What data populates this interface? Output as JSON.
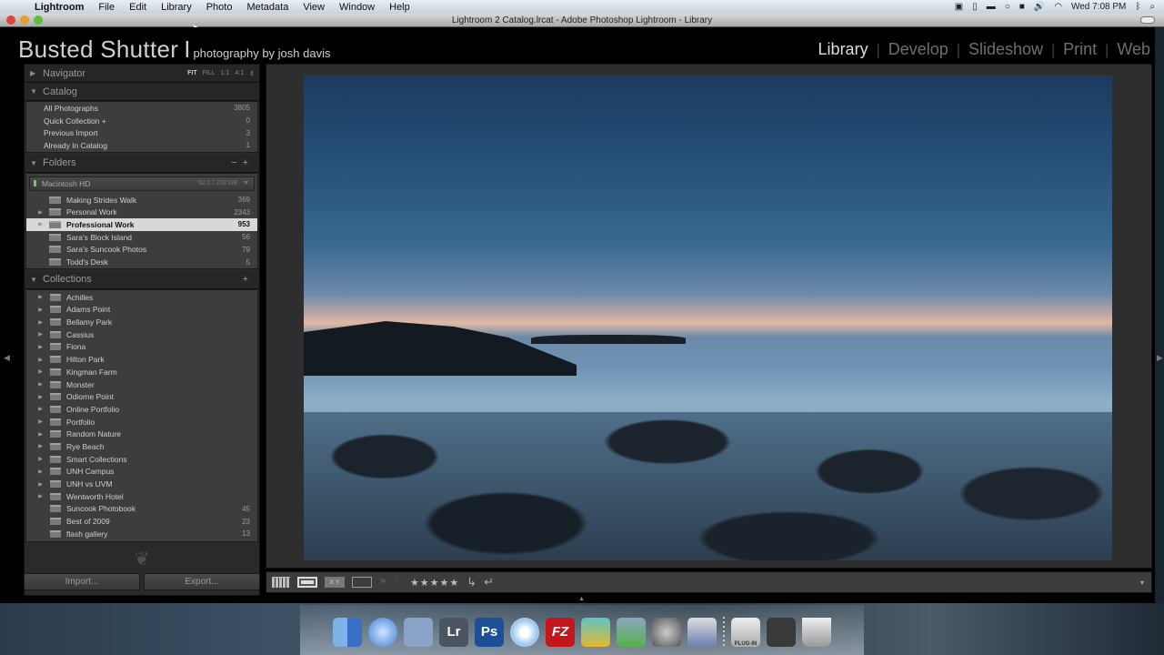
{
  "menubar": {
    "apple_icon": "apple-logo",
    "app_name": "Lightroom",
    "items": [
      "File",
      "Edit",
      "Library",
      "Photo",
      "Metadata",
      "View",
      "Window",
      "Help"
    ],
    "status_icons": [
      "screen-record-icon",
      "battery-monitor-icon",
      "ram-icon",
      "speech-bubble-icon",
      "one-password-icon",
      "volume-icon",
      "wifi-icon"
    ],
    "clock": "Wed 7:08 PM",
    "bluetooth_icon": "bluetooth-icon",
    "spotlight_icon": "search-icon"
  },
  "window": {
    "title": "Lightroom 2 Catalog.lrcat - Adobe Photoshop Lightroom - Library"
  },
  "identity_plate": {
    "name": "Busted Shutter",
    "separator": "I",
    "tagline": "photography by josh davis"
  },
  "modules": {
    "items": [
      "Library",
      "Develop",
      "Slideshow",
      "Print",
      "Web"
    ],
    "active": "Library",
    "separator": "|"
  },
  "navigator": {
    "title": "Navigator",
    "zoom_options": [
      "FIT",
      "FILL",
      "1:1",
      "4:1"
    ],
    "active_zoom": "FIT"
  },
  "catalog": {
    "title": "Catalog",
    "items": [
      {
        "label": "All Photographs",
        "count": "3805"
      },
      {
        "label": "Quick Collection +",
        "count": "0"
      },
      {
        "label": "Previous Import",
        "count": "3"
      },
      {
        "label": "Already In Catalog",
        "count": "1"
      }
    ]
  },
  "folders": {
    "title": "Folders",
    "minus": "−",
    "plus": "+",
    "volume": {
      "name": "Macintosh HD",
      "capacity": "92.2 / 233 GB"
    },
    "items": [
      {
        "label": "Making Strides Walk",
        "count": "369",
        "expandable": false
      },
      {
        "label": "Personal Work",
        "count": "2343",
        "expandable": true
      },
      {
        "label": "Professional Work",
        "count": "953",
        "expandable": true,
        "selected": true
      },
      {
        "label": "Sara's Block Island",
        "count": "56",
        "expandable": false
      },
      {
        "label": "Sara's Suncook Photos",
        "count": "79",
        "expandable": false
      },
      {
        "label": "Todd's Desk",
        "count": "5",
        "expandable": false
      }
    ]
  },
  "collections": {
    "title": "Collections",
    "plus": "+",
    "items": [
      {
        "label": "Achilles",
        "count": ""
      },
      {
        "label": "Adams Point",
        "count": ""
      },
      {
        "label": "Bellamy Park",
        "count": ""
      },
      {
        "label": "Cassius",
        "count": ""
      },
      {
        "label": "Fiona",
        "count": ""
      },
      {
        "label": "Hilton Park",
        "count": ""
      },
      {
        "label": "Kingman Farm",
        "count": ""
      },
      {
        "label": "Monster",
        "count": ""
      },
      {
        "label": "Odiorne Point",
        "count": ""
      },
      {
        "label": "Online Portfolio",
        "count": ""
      },
      {
        "label": "Portfolio",
        "count": ""
      },
      {
        "label": "Random Nature",
        "count": ""
      },
      {
        "label": "Rye Beach",
        "count": ""
      },
      {
        "label": "Smart Collections",
        "count": ""
      },
      {
        "label": "UNH Campus",
        "count": ""
      },
      {
        "label": "UNH vs UVM",
        "count": ""
      },
      {
        "label": "Wentworth Hotel",
        "count": ""
      },
      {
        "label": "Suncook Photobook",
        "count": "45"
      },
      {
        "label": "Best of 2009",
        "count": "23"
      },
      {
        "label": "flash gallery",
        "count": "13"
      }
    ]
  },
  "buttons": {
    "import": "Import...",
    "export": "Export..."
  },
  "toolbar": {
    "view_modes": [
      "grid-view",
      "loupe-view",
      "compare-view",
      "survey-view"
    ],
    "compare_label": "X Y",
    "rating": "★★★★★",
    "rotate_left": "↳",
    "rotate_right": "↵",
    "dropdown": "▾"
  },
  "photo": {
    "description": "Long-exposure seascape at dusk with rocks in the foreground"
  },
  "dock": {
    "apps": [
      "Finder",
      "Safari",
      "Mail",
      "Lr",
      "Ps",
      "iTunes",
      "FZ",
      "Keychain",
      "Boot Camp",
      "System Preferences",
      "iMovie",
      "Plug-in",
      "Calculator",
      "Trash"
    ]
  }
}
